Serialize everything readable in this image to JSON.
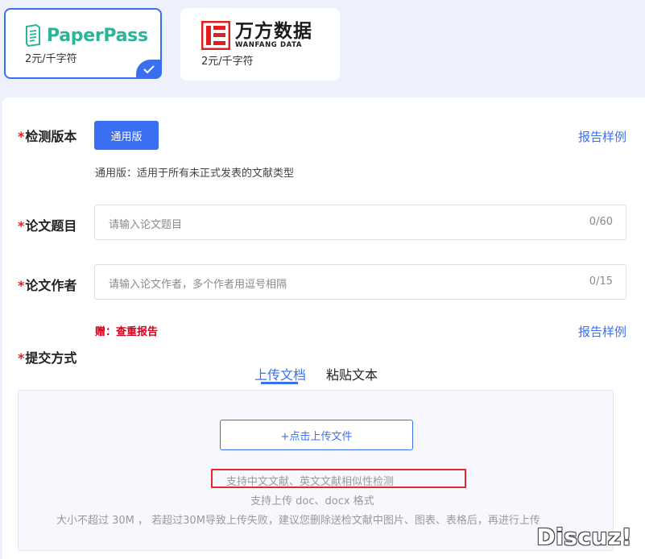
{
  "products": [
    {
      "brand": "PaperPass",
      "price": "2元/千字符",
      "selected": true
    },
    {
      "brand_cn": "万方数据",
      "brand_en": "WANFANG DATA",
      "price": "2元/千字符",
      "selected": false
    }
  ],
  "form": {
    "version": {
      "label": "检测版本",
      "button": "通用版",
      "description": "通用版：适用于所有未正式发表的文献类型",
      "sample_link": "报告样例"
    },
    "title": {
      "label": "论文题目",
      "placeholder": "请输入论文题目",
      "counter": "0/60"
    },
    "author": {
      "label": "论文作者",
      "placeholder": "请输入论文作者，多个作者用逗号相隔",
      "counter": "0/15"
    },
    "gift": "赠：查重报告",
    "gift_sample_link": "报告样例",
    "submit": {
      "label": "提交方式",
      "tabs": [
        "上传文档",
        "粘贴文本"
      ],
      "upload_button": "+点击上传文件",
      "hints": [
        "支持中文文献、英文文献相似性检测",
        "支持上传 doc、docx 格式",
        "大小不超过 30M ， 若超过30M导致上传失败，建议您删除送检文献中图片、图表、表格后，再进行上传"
      ]
    }
  },
  "required_mark": "*",
  "watermark": "Discuz!",
  "colors": {
    "accent": "#3a6ff2",
    "required": "#e02020",
    "gift": "#d0021b",
    "highlight": "#e8262d",
    "paperpass_green": "#2ab49a",
    "wanfang_red": "#e02020"
  }
}
